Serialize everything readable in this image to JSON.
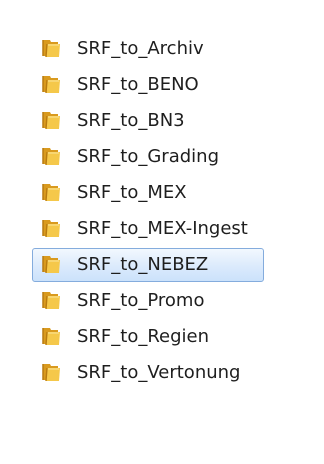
{
  "folders": [
    {
      "name": "SRF_to_Archiv",
      "icon": "folder-icon",
      "selected": false
    },
    {
      "name": "SRF_to_BENO",
      "icon": "folder-icon",
      "selected": false
    },
    {
      "name": "SRF_to_BN3",
      "icon": "folder-icon",
      "selected": false
    },
    {
      "name": "SRF_to_Grading",
      "icon": "folder-icon",
      "selected": false
    },
    {
      "name": "SRF_to_MEX",
      "icon": "folder-icon",
      "selected": false
    },
    {
      "name": "SRF_to_MEX-Ingest",
      "icon": "folder-icon",
      "selected": false
    },
    {
      "name": "SRF_to_NEBEZ",
      "icon": "folder-icon",
      "selected": true
    },
    {
      "name": "SRF_to_Promo",
      "icon": "folder-icon",
      "selected": false
    },
    {
      "name": "SRF_to_Regien",
      "icon": "folder-icon",
      "selected": false
    },
    {
      "name": "SRF_to_Vertonung",
      "icon": "folder-icon",
      "selected": false
    }
  ],
  "colors": {
    "folder_front": "#f5c84a",
    "folder_back": "#d99a1e",
    "folder_spine": "#b87a10",
    "selection_border": "#84acdd",
    "selection_fill": "#dbeafc",
    "text": "#1e1e1e"
  }
}
